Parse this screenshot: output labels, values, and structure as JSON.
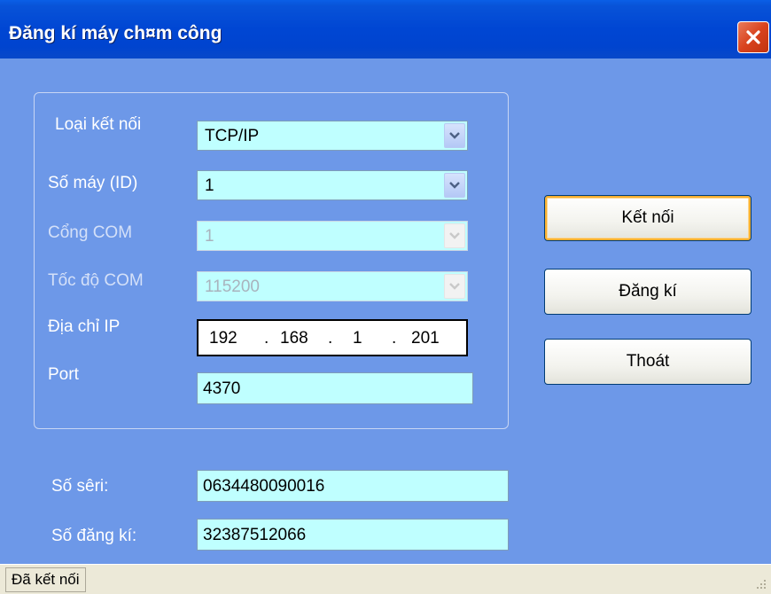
{
  "window": {
    "title": "Đăng kí máy ch¤m công"
  },
  "form": {
    "connection_type": {
      "label": "Loại kết nối",
      "value": "TCP/IP"
    },
    "machine_id": {
      "label": "Số máy (ID)",
      "value": "1"
    },
    "com_port": {
      "label": "Cổng COM",
      "value": "1",
      "enabled": false
    },
    "com_speed": {
      "label": "Tốc độ COM",
      "value": "115200",
      "enabled": false
    },
    "ip_address": {
      "label": "Địa chỉ IP",
      "octet1": "192",
      "octet2": "168",
      "octet3": "1",
      "octet4": "201",
      "dot": "."
    },
    "port": {
      "label": "Port",
      "value": "4370"
    },
    "serial": {
      "label": "Số sêri:",
      "value": "0634480090016"
    },
    "registration_no": {
      "label": "Số đăng kí:",
      "value": "32387512066"
    }
  },
  "buttons": {
    "connect": "Kết nối",
    "register": "Đăng kí",
    "exit": "Thoát"
  },
  "status": {
    "text": "Đã kết nối"
  },
  "colors": {
    "window_bg": "#6D98E8",
    "field_bg": "#BFFFFF",
    "titlebar": "#0046D3",
    "close": "#D9431E"
  },
  "icons": {
    "close": "close-icon",
    "dropdown": "chevron-down-icon",
    "grip": "resize-grip-icon"
  }
}
